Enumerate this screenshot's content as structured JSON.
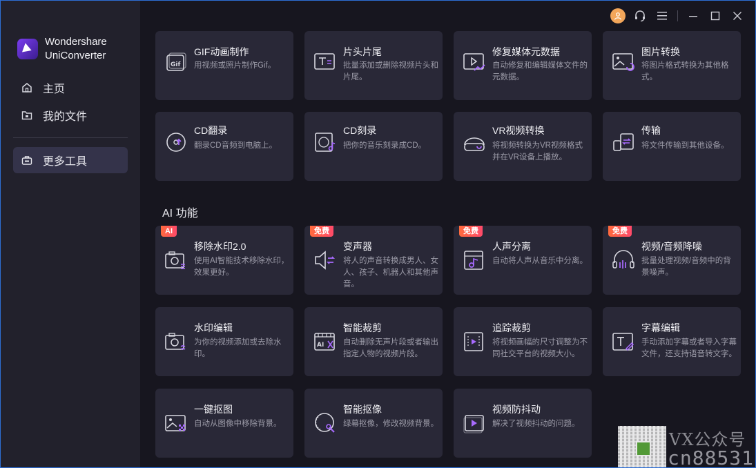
{
  "app": {
    "name_line1": "Wondershare",
    "name_line2": "UniConverter"
  },
  "nav": {
    "home": "主页",
    "files": "我的文件",
    "more_tools": "更多工具"
  },
  "colors": {
    "accent": "#7b3df0",
    "badge": "#ff5a4a",
    "active_nav": "#34334a",
    "card_bg": "#292837"
  },
  "tools": [
    {
      "title": "GIF动画制作",
      "desc": "用视频或照片制作Gif。",
      "icon": "gif-icon"
    },
    {
      "title": "片头片尾",
      "desc": "批量添加或删除视频片头和片尾。",
      "icon": "intro-outro-icon"
    },
    {
      "title": "修复媒体元数据",
      "desc": "自动修复和编辑媒体文件的元数据。",
      "icon": "metadata-icon"
    },
    {
      "title": "图片转换",
      "desc": "将图片格式转换为其他格式。",
      "icon": "image-convert-icon"
    },
    {
      "title": "CD翻录",
      "desc": "翻录CD音频到电脑上。",
      "icon": "cd-rip-icon"
    },
    {
      "title": "CD刻录",
      "desc": "把你的音乐刻录成CD。",
      "icon": "cd-burn-icon"
    },
    {
      "title": "VR视频转换",
      "desc": "将视频转换为VR视频格式并在VR设备上播放。",
      "icon": "vr-icon"
    },
    {
      "title": "传输",
      "desc": "将文件传输到其他设备。",
      "icon": "transfer-icon"
    }
  ],
  "ai_section": {
    "title": "AI 功能",
    "tools": [
      {
        "title": "移除水印2.0",
        "desc": "使用AI智能技术移除水印，效果更好。",
        "badge": "AI",
        "icon": "watermark-remove-icon"
      },
      {
        "title": "变声器",
        "desc": "将人的声音转换成男人、女人、孩子、机器人和其他声音。",
        "badge": "免费",
        "icon": "voice-changer-icon"
      },
      {
        "title": "人声分离",
        "desc": "自动将人声从音乐中分离。",
        "badge": "免费",
        "icon": "vocal-separate-icon"
      },
      {
        "title": "视频/音频降噪",
        "desc": "批量处理视频/音频中的背景噪声。",
        "badge": "免费",
        "icon": "noise-reduce-icon"
      },
      {
        "title": "水印编辑",
        "desc": "为你的视频添加或去除水印。",
        "icon": "watermark-edit-icon"
      },
      {
        "title": "智能裁剪",
        "desc": "自动删除无声片段或者输出指定人物的视频片段。",
        "icon": "smart-trim-icon"
      },
      {
        "title": "追踪裁剪",
        "desc": "将视频画幅的尺寸调整为不同社交平台的视频大小。",
        "icon": "auto-reframe-icon"
      },
      {
        "title": "字幕编辑",
        "desc": "手动添加字幕或者导入字幕文件，还支持语音转文字。",
        "icon": "subtitle-icon"
      },
      {
        "title": "一键抠图",
        "desc": "自动从图像中移除背景。",
        "icon": "bg-remove-icon"
      },
      {
        "title": "智能抠像",
        "desc": "绿幕抠像，修改视频背景。",
        "icon": "smart-cutout-icon"
      },
      {
        "title": "视频防抖动",
        "desc": "解决了视频抖动的问题。",
        "icon": "stabilize-icon"
      }
    ]
  },
  "watermark": {
    "line1": "VX公众号",
    "line2": "cn88531"
  }
}
